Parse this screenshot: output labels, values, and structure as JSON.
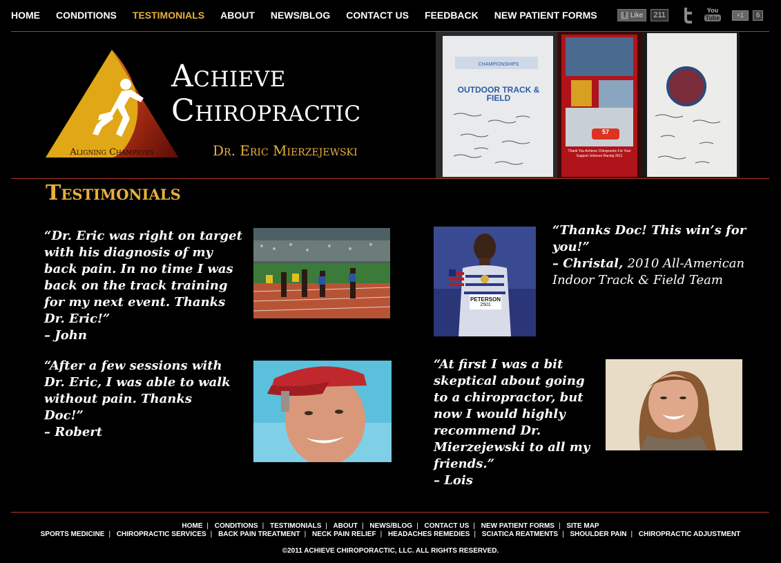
{
  "nav": {
    "items": [
      {
        "label": "HOME",
        "active": false
      },
      {
        "label": "CONDITIONS",
        "active": false
      },
      {
        "label": "TESTIMONIALS",
        "active": true
      },
      {
        "label": "ABOUT",
        "active": false
      },
      {
        "label": "NEWS/BLOG",
        "active": false
      },
      {
        "label": "CONTACT US",
        "active": false
      },
      {
        "label": "FEEDBACK",
        "active": false
      },
      {
        "label": "NEW PATIENT FORMS",
        "active": false
      }
    ]
  },
  "social": {
    "fb_like_label": "Like",
    "fb_like_count": "211",
    "youtube_label_top": "You",
    "youtube_label_bottom": "Tube",
    "gplus_label": "+1",
    "gplus_count": "6"
  },
  "header": {
    "brand_line1": "Achieve",
    "brand_line2": "Chiropractic",
    "logo_tagline": "Aligning Champions",
    "doctor": "Dr. Eric Mierzejewski",
    "photo_text_1": "OUTDOOR TRACK & FIELD",
    "photo_text_2": "CHAMPIONSHIPS",
    "photo_text_3": "Thank You Achieve Chiropractic For Your Support Johnson Racing 2011",
    "photo_text_4": "57"
  },
  "section": {
    "title": "Testimonials"
  },
  "testimonials": [
    {
      "quote": "“Dr. Eric was right on target with his diagnosis of my back pain. In no time I was back on the track training for my next event. Thanks Dr. Eric!”",
      "author": "– John",
      "subtitle": ""
    },
    {
      "quote": "“Thanks Doc! This win’s for you!”",
      "author": "– Christal,",
      "subtitle": "2010 All-American Indoor Track & Field Team"
    },
    {
      "quote": "“After a few sessions with Dr. Eric, I was able to walk without pain. Thanks Doc!”",
      "author": "– Robert",
      "subtitle": ""
    },
    {
      "quote": "“At first I was a bit skeptical about going to a chiropractor, but now I would highly recommend Dr. Mierzejewski to all my friends.”",
      "author": "– Lois",
      "subtitle": ""
    }
  ],
  "photo_labels": {
    "bib_name": "PETERSON",
    "bib_number": "2501"
  },
  "footer": {
    "row1": [
      "HOME",
      "CONDITIONS",
      "TESTIMONIALS",
      "ABOUT",
      "NEWS/BLOG",
      "CONTACT US",
      "NEW PATIENT FORMS",
      "SITE MAP"
    ],
    "row2": [
      "SPORTS MEDICINE",
      "CHIROPRACTIC SERVICES",
      "BACK PAIN TREATMENT",
      "NECK PAIN RELIEF",
      "HEADACHES REMEDIES",
      "SCIATICA REATMENTS",
      "SHOULDER PAIN",
      "CHIROPRACTIC ADJUSTMENT"
    ],
    "copyright": "©2011 ACHIEVE CHIROPORACTIC, LLC. ALL RIGHTS RESERVED."
  },
  "colors": {
    "accent": "#e8b13a",
    "divider": "#b33a2a",
    "background": "#000000"
  }
}
